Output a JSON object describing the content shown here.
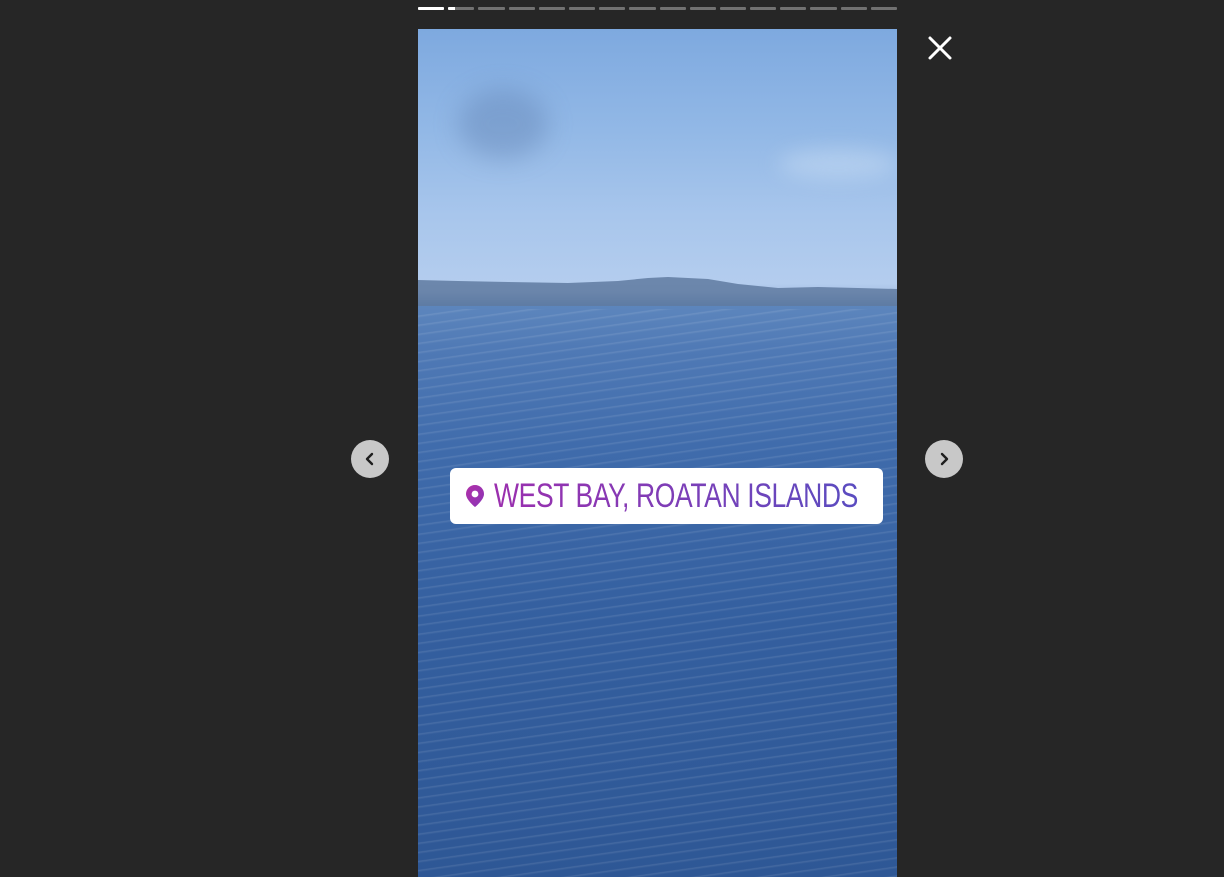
{
  "story": {
    "total_segments": 16,
    "current_segment_index": 1,
    "current_segment_progress": 0.25,
    "location_sticker": {
      "text": "WEST BAY, ROATAN ISLANDS",
      "icon": "location-pin-icon"
    }
  },
  "controls": {
    "close_icon": "close-icon",
    "prev_icon": "chevron-left-icon",
    "next_icon": "chevron-right-icon"
  },
  "colors": {
    "background": "#262626",
    "sticker_gradient_start": "#9b2fae",
    "sticker_gradient_end": "#5a4cc0",
    "nav_button": "#c8c8c8"
  }
}
